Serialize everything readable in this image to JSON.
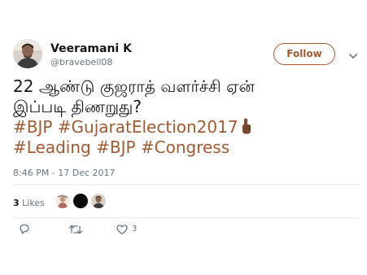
{
  "user": {
    "name": "Veeramani K",
    "handle": "@bravebell08"
  },
  "follow_label": "Follow",
  "tweet": {
    "line1": "22 ஆண்டு குஜராத் வளர்ச்சி ஏன்",
    "line2": "இப்படி திணறுது?",
    "hashtags_line1": [
      "#BJP",
      "#GujaratElection2017"
    ],
    "hashtags_line2": [
      "#Leading",
      "#BJP",
      "#Congress"
    ],
    "emoji": "index-pointing-up-dark-skin-tone"
  },
  "timestamp": "8:46 PM - 17 Dec 2017",
  "likes": {
    "count": "3",
    "label": "Likes"
  },
  "actions": {
    "like_count": "3"
  },
  "colors": {
    "accent": "#a15a31",
    "text": "#14171a",
    "secondary": "#657786",
    "divider": "#e6ecf0"
  },
  "icons": [
    "chevron-down-icon",
    "reply-icon",
    "retweet-icon",
    "heart-icon"
  ]
}
